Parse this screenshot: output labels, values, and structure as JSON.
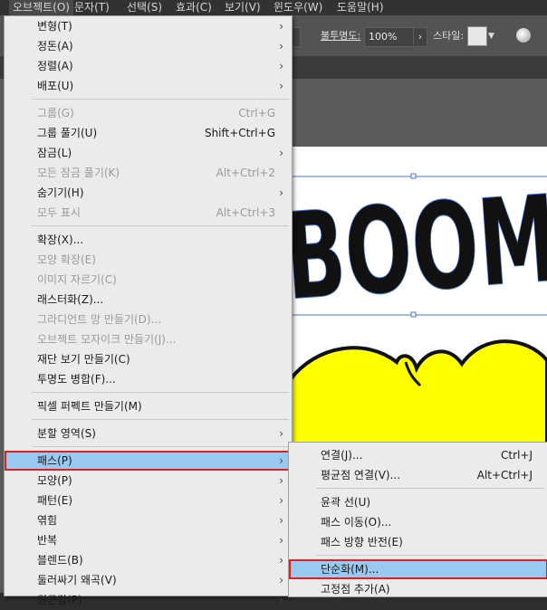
{
  "menubar": [
    {
      "label": "오브젝트(O)",
      "active": true
    },
    {
      "label": "문자(T)"
    },
    {
      "label": "선택(S)"
    },
    {
      "label": "효과(C)"
    },
    {
      "label": "보기(V)"
    },
    {
      "label": "윈도우(W)"
    },
    {
      "label": "도움말(H)"
    }
  ],
  "control_bar": {
    "opacity_label": "불투명도:",
    "opacity_value": "100%",
    "style_label": "스타일:"
  },
  "canvas": {
    "art_text": "BOOM"
  },
  "main_menu": [
    {
      "label": "변형(T)",
      "arrow": true
    },
    {
      "label": "정돈(A)",
      "arrow": true
    },
    {
      "label": "정렬(A)",
      "arrow": true
    },
    {
      "label": "배포(U)",
      "arrow": true
    },
    {
      "sep": true
    },
    {
      "label": "그룹(G)",
      "shortcut": "Ctrl+G",
      "disabled": true
    },
    {
      "label": "그룹 풀기(U)",
      "shortcut": "Shift+Ctrl+G"
    },
    {
      "label": "잠금(L)",
      "arrow": true
    },
    {
      "label": "모든 잠금 풀기(K)",
      "shortcut": "Alt+Ctrl+2",
      "disabled": true
    },
    {
      "label": "숨기기(H)",
      "arrow": true
    },
    {
      "label": "모두 표시",
      "shortcut": "Alt+Ctrl+3",
      "disabled": true
    },
    {
      "sep": true
    },
    {
      "label": "확장(X)..."
    },
    {
      "label": "모양 확장(E)",
      "disabled": true
    },
    {
      "label": "이미지 자르기(C)",
      "disabled": true
    },
    {
      "label": "래스터화(Z)..."
    },
    {
      "label": "그라디언트 망 만들기(D)...",
      "disabled": true
    },
    {
      "label": "오브젝트 모자이크 만들기(J)...",
      "disabled": true
    },
    {
      "label": "재단 보기 만들기(C)"
    },
    {
      "label": "투명도 병합(F)..."
    },
    {
      "sep": true
    },
    {
      "label": "픽셀 퍼펙트 만들기(M)"
    },
    {
      "sep": true
    },
    {
      "label": "분할 영역(S)",
      "arrow": true
    },
    {
      "sep": true
    },
    {
      "label": "패스(P)",
      "arrow": true,
      "highlighted": true
    },
    {
      "label": "모양(P)",
      "arrow": true
    },
    {
      "label": "패턴(E)",
      "arrow": true
    },
    {
      "label": "엮힘",
      "arrow": true
    },
    {
      "label": "반복",
      "arrow": true
    },
    {
      "label": "블렌드(B)",
      "arrow": true
    },
    {
      "label": "둘러싸기 왜곡(V)",
      "arrow": true
    },
    {
      "label": "원근감(P)",
      "arrow": true
    }
  ],
  "path_submenu": [
    {
      "label": "연결(J)...",
      "shortcut": "Ctrl+J"
    },
    {
      "label": "평균점 연결(V)...",
      "shortcut": "Alt+Ctrl+J"
    },
    {
      "sep": true
    },
    {
      "label": "윤곽 선(U)"
    },
    {
      "label": "패스 이동(O)..."
    },
    {
      "label": "패스 방향 반전(E)"
    },
    {
      "sep": true
    },
    {
      "label": "단순화(M)...",
      "highlighted": true
    },
    {
      "label": "고정점 추가(A)"
    }
  ]
}
